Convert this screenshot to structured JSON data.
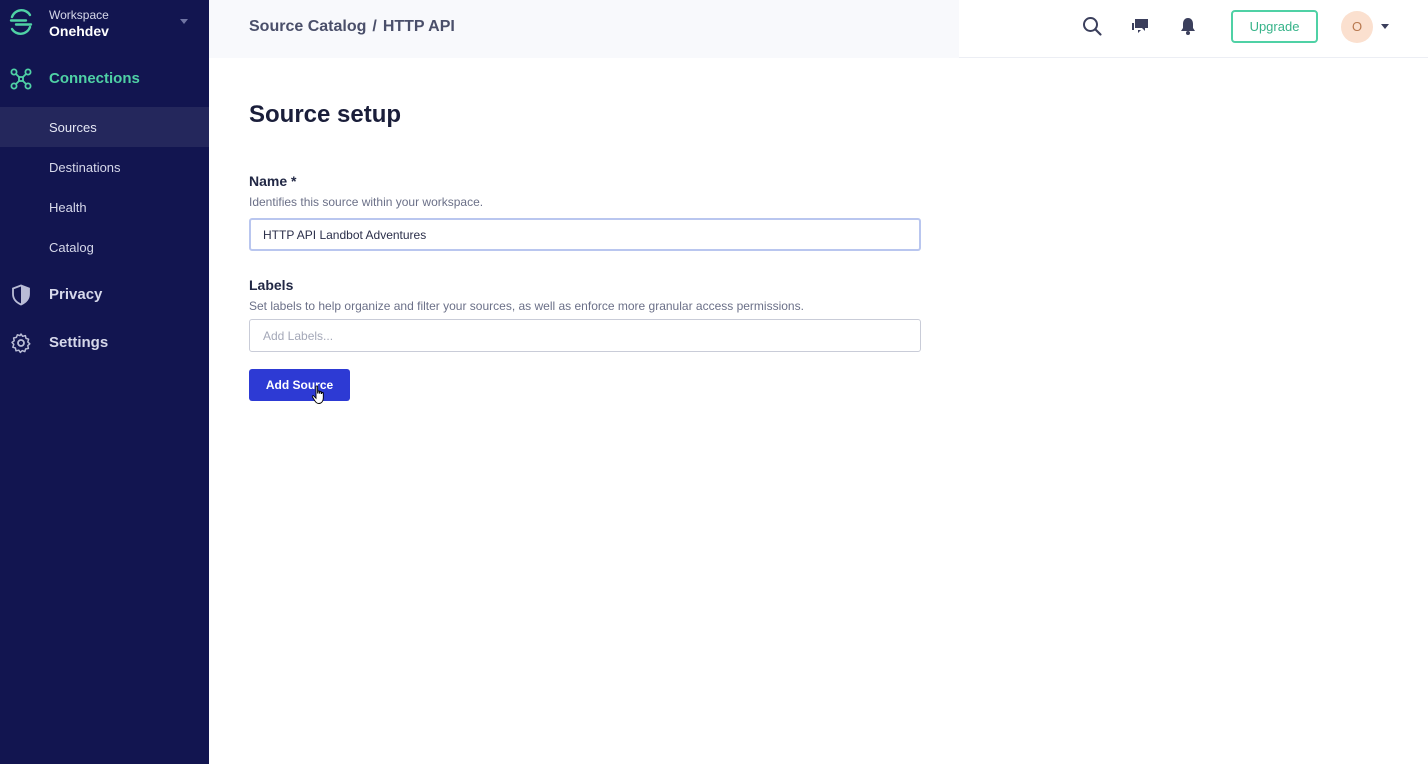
{
  "workspace": {
    "label": "Workspace",
    "name": "Onehdev"
  },
  "sidebar": {
    "connections": "Connections",
    "sub_items": [
      "Sources",
      "Destinations",
      "Health",
      "Catalog"
    ],
    "privacy": "Privacy",
    "settings": "Settings"
  },
  "header": {
    "breadcrumb": [
      "Source Catalog",
      "HTTP API"
    ],
    "separator": "/",
    "upgrade_label": "Upgrade",
    "avatar_initial": "O"
  },
  "main": {
    "title": "Source setup",
    "name_label": "Name *",
    "name_help": "Identifies this source within your workspace.",
    "name_value": "HTTP API Landbot Adventures",
    "labels_label": "Labels",
    "labels_help": "Set labels to help organize and filter your sources, as well as enforce more granular access permissions.",
    "labels_placeholder": "Add Labels...",
    "add_button": "Add Source"
  },
  "colors": {
    "sidebar_bg": "#121550",
    "accent_green": "#4fd1a5",
    "primary_button": "#2d3ad4"
  },
  "icons": [
    "logo-icon",
    "connections-icon",
    "privacy-icon",
    "settings-icon",
    "search-icon",
    "chat-icon",
    "bell-icon"
  ]
}
